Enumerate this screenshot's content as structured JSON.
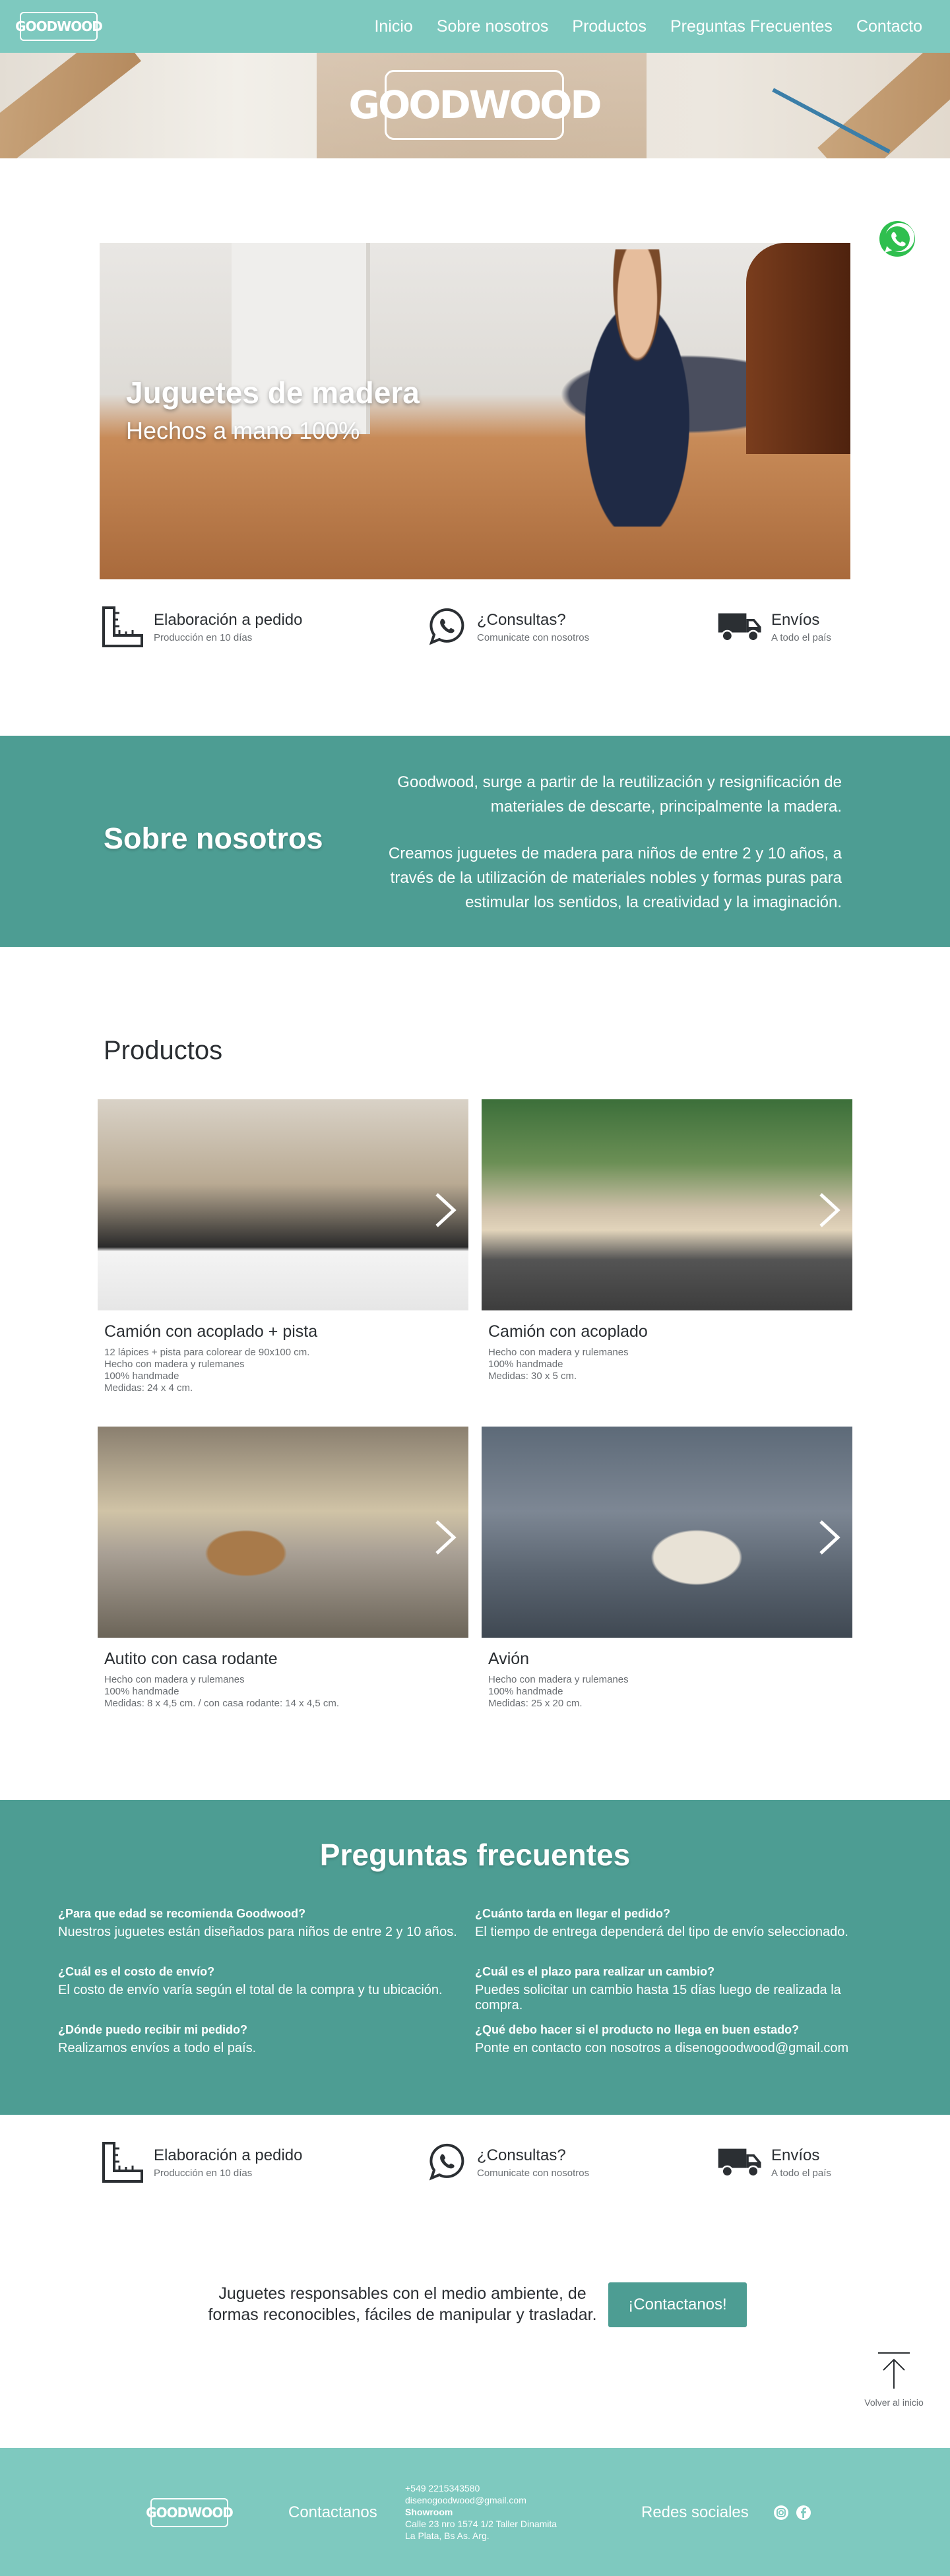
{
  "brand": {
    "logo_text": "GOODWOOD"
  },
  "nav": {
    "items": [
      {
        "label": "Inicio"
      },
      {
        "label": "Sobre nosotros"
      },
      {
        "label": "Productos"
      },
      {
        "label": "Preguntas Frecuentes"
      },
      {
        "label": "Contacto"
      }
    ]
  },
  "hero": {
    "title": "Juguetes de madera",
    "subtitle": "Hechos a mano 100%"
  },
  "features": [
    {
      "title": "Elaboración a pedido",
      "subtitle": "Producción en 10 días",
      "icon": "ruler-icon"
    },
    {
      "title": "¿Consultas?",
      "subtitle": "Comunicate con nosotros",
      "icon": "whatsapp-icon"
    },
    {
      "title": "Envíos",
      "subtitle": "A todo el país",
      "icon": "truck-icon"
    }
  ],
  "about": {
    "title": "Sobre nosotros",
    "p1": "Goodwood, surge a partir de la reutilización y resignificación de materiales de descarte, principalmente la madera.",
    "p2": "Creamos juguetes de madera para niños de entre 2 y 10 años, a través de la utilización de materiales nobles y formas puras para estimular los sentidos, la creatividad y la imaginación."
  },
  "products": {
    "title": "Productos",
    "items": [
      {
        "title": "Camión con acoplado + pista",
        "desc": [
          "12 lápices + pista para colorear de 90x100 cm.",
          "Hecho con madera y rulemanes",
          "100% handmade",
          "Medidas: 24 x 4 cm."
        ]
      },
      {
        "title": "Camión con acoplado",
        "desc": [
          "Hecho con madera y rulemanes",
          "100% handmade",
          "Medidas: 30 x 5 cm."
        ]
      },
      {
        "title": "Autito con casa rodante",
        "desc": [
          "Hecho con madera y rulemanes",
          "100% handmade",
          "Medidas: 8 x 4,5 cm. / con casa rodante: 14 x 4,5 cm."
        ]
      },
      {
        "title": "Avión",
        "desc": [
          "Hecho con madera y rulemanes",
          "100% handmade",
          "Medidas: 25 x 20 cm."
        ]
      }
    ]
  },
  "faq": {
    "title": "Preguntas frecuentes",
    "items": [
      {
        "q": "¿Para que edad se recomienda Goodwood?",
        "a": "Nuestros juguetes están diseñados para niños de entre 2 y 10 años."
      },
      {
        "q": "¿Cuánto tarda en llegar el pedido?",
        "a": "El tiempo de entrega dependerá del tipo de envío seleccionado."
      },
      {
        "q": "¿Cuál es el costo de envío?",
        "a": "El costo de envío varía según el total de la compra y tu ubicación."
      },
      {
        "q": "¿Cuál es el plazo para realizar un cambio?",
        "a": "Puedes solicitar un cambio hasta 15 días luego de realizada la compra."
      },
      {
        "q": "¿Dónde puedo recibir mi pedido?",
        "a": "Realizamos envíos a todo el país."
      },
      {
        "q": "¿Qué debo hacer si el producto no llega en buen estado?",
        "a": "Ponte en contacto con nosotros a disenogoodwood@gmail.com"
      }
    ]
  },
  "cta": {
    "text": "Juguetes responsables con el medio ambiente, de formas reconocibles, fáciles de manipular y trasladar.",
    "button": "¡Contactanos!"
  },
  "back_to_top": {
    "label": "Volver al inicio"
  },
  "footer": {
    "contact_label": "Contactanos",
    "phone": "+549 2215343580",
    "email": "disenogoodwood@gmail.com",
    "showroom_label": "Showroom",
    "address1": "Calle 23 nro 1574 1/2 Taller Dinamita",
    "address2": "La Plata, Bs As. Arg.",
    "social_label": "Redes sociales"
  },
  "colors": {
    "teal_light": "#7ec9bf",
    "teal_dark": "#4d9d93",
    "text": "#2b2f33",
    "whatsapp": "#2fbf4f"
  }
}
